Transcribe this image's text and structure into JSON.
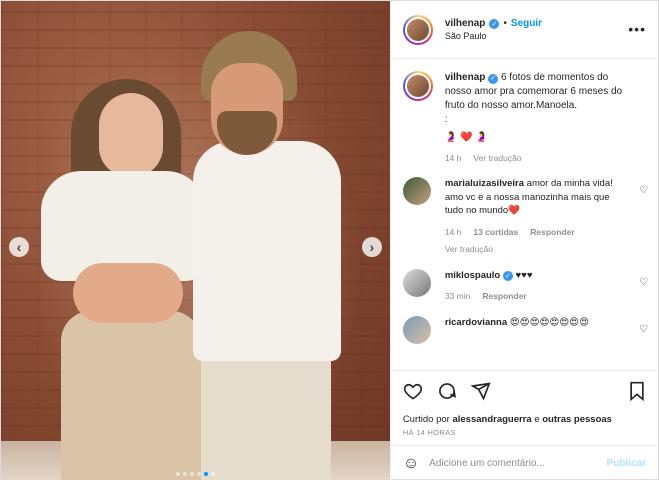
{
  "header": {
    "username": "vilhenap",
    "separator": "•",
    "follow_label": "Seguir",
    "location": "São Paulo",
    "more": "•••"
  },
  "caption": {
    "username": "vilhenap",
    "text": "6 fotos de momentos do nosso amor pra comemorar 6 meses do fruto do nosso amor.Manoela.",
    "colon": ":",
    "emojis": "🤰 ❤️ 🤰",
    "time": "14 h",
    "translate": "Ver tradução"
  },
  "comments": [
    {
      "username": "marialuizasilveira",
      "text": "amor da minha vida! amo vc e a nossa manozinha mais que tudo no mundo❤️",
      "time": "14 h",
      "likes": "13 curtidas",
      "reply": "Responder",
      "translate": "Ver tradução"
    },
    {
      "username": "miklospaulo",
      "text": "♥♥♥",
      "time": "33 min",
      "reply": "Responder"
    },
    {
      "username": "ricardovianna",
      "text": "😍😍😍😍😍😍😍😍"
    }
  ],
  "liked_by": {
    "prefix": "Curtido por",
    "user": "alessandraguerra",
    "middle": "e",
    "others": "outras pessoas"
  },
  "timestamp": "HÁ 14 HORAS",
  "add_comment": {
    "placeholder": "Adicione um comentário...",
    "publish": "Publicar"
  },
  "carousel": {
    "slides": 6,
    "active_index": 4
  },
  "colors": {
    "accent": "#0095f6",
    "verified": "#3897f0",
    "publish_disabled": "#b2dffc"
  },
  "icons": {
    "like": "heart-icon",
    "comment": "comment-icon",
    "share": "share-icon",
    "save": "bookmark-icon",
    "emoji": "emoji-icon"
  }
}
